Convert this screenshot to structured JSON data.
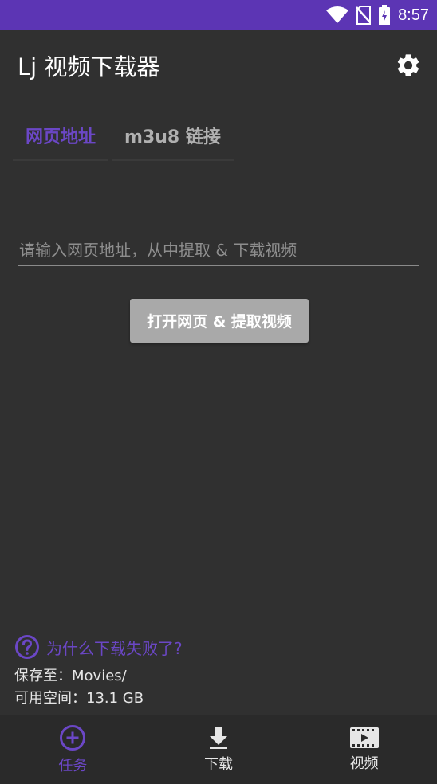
{
  "status_bar": {
    "time": "8:57",
    "icons": [
      "wifi-icon",
      "no-sim-icon",
      "battery-charging-icon"
    ]
  },
  "app_bar": {
    "title": "Lj 视频下载器",
    "settings_icon": "gear-icon"
  },
  "tabs": [
    {
      "label": "网页地址",
      "active": true
    },
    {
      "label": "m3u8 链接",
      "active": false
    }
  ],
  "url_input": {
    "value": "",
    "placeholder": "请输入网页地址，从中提取 & 下载视频"
  },
  "open_button": {
    "label": "打开网页 & 提取视频"
  },
  "help": {
    "icon": "question-circle-icon",
    "text": "为什么下载失败了?"
  },
  "storage": {
    "save_to": "保存至：Movies/",
    "free_space": "可用空间：13.1 GB"
  },
  "bottom_nav": {
    "items": [
      {
        "label": "任务",
        "icon": "add-circle-icon",
        "active": true
      },
      {
        "label": "下载",
        "icon": "download-icon",
        "active": false
      },
      {
        "label": "视频",
        "icon": "video-library-icon",
        "active": false
      }
    ]
  },
  "colors": {
    "accent": "#6b47c6",
    "status_bar": "#5c35b4",
    "background": "#303030",
    "bottom_nav": "#2a2a2a",
    "button": "#a9a9a9"
  }
}
